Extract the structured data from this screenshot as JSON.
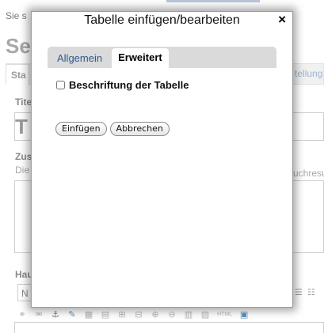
{
  "background": {
    "breadcrumb": "Sie s",
    "page_title": "Se",
    "tab_left": "Sta",
    "tab_right": "tellung",
    "label_title": "Tite",
    "title_value": "T",
    "label_summary": "Zus",
    "summary_hint": "Die",
    "right_note": "uchresu",
    "label_main": "Hau",
    "select_value": "N",
    "toolbar_html": "HTML"
  },
  "dialog": {
    "title": "Tabelle einfügen/bearbeiten",
    "close_symbol": "×",
    "tabs": [
      {
        "label": "Allgemein",
        "active": false
      },
      {
        "label": "Erweitert",
        "active": true
      }
    ],
    "option_label": "Beschriftung der Tabelle",
    "option_checked": false,
    "insert_button": "Einfügen",
    "cancel_button": "Abbrechen"
  },
  "colors": {
    "accent_link": "#2b5d92",
    "tab_bar": "#dadada"
  }
}
